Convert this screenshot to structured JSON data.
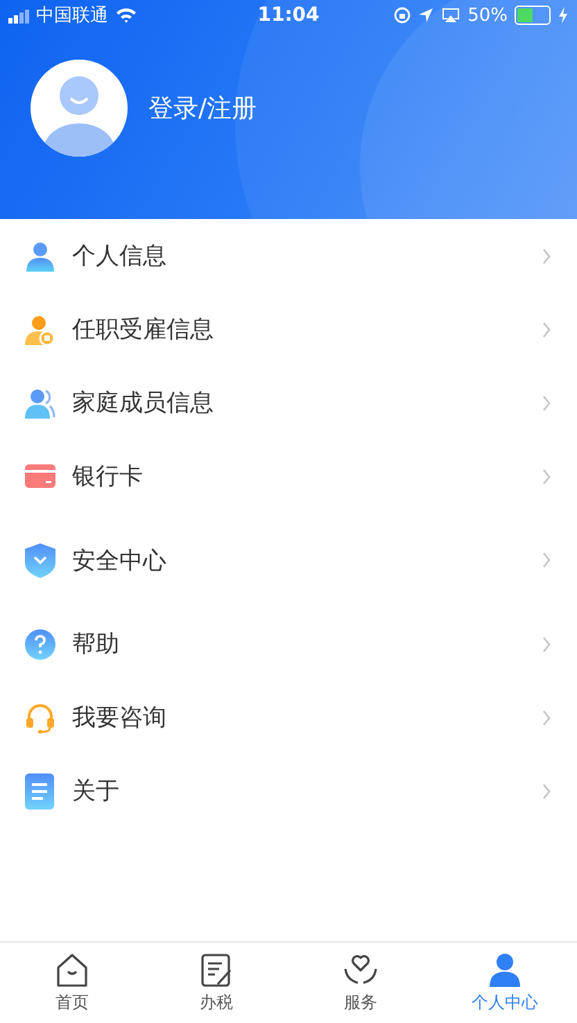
{
  "status_bar": {
    "carrier": "中国联通",
    "time": "11:04",
    "battery": "50%"
  },
  "profile": {
    "login_label": "登录/注册"
  },
  "menu": [
    {
      "label": "个人信息",
      "kind": "person"
    },
    {
      "label": "任职受雇信息",
      "kind": "employee"
    },
    {
      "label": "家庭成员信息",
      "kind": "family"
    },
    {
      "label": "银行卡",
      "kind": "card"
    },
    {
      "label": "安全中心",
      "kind": "shield"
    },
    {
      "label": "帮助",
      "kind": "help"
    },
    {
      "label": "我要咨询",
      "kind": "headset"
    },
    {
      "label": "关于",
      "kind": "doc"
    }
  ],
  "tab_bar": [
    {
      "label": "首页",
      "kind": "home",
      "selected": false
    },
    {
      "label": "办税",
      "kind": "tax",
      "selected": false
    },
    {
      "label": "服务",
      "kind": "service",
      "selected": false
    },
    {
      "label": "个人中心",
      "kind": "me",
      "selected": true
    }
  ]
}
